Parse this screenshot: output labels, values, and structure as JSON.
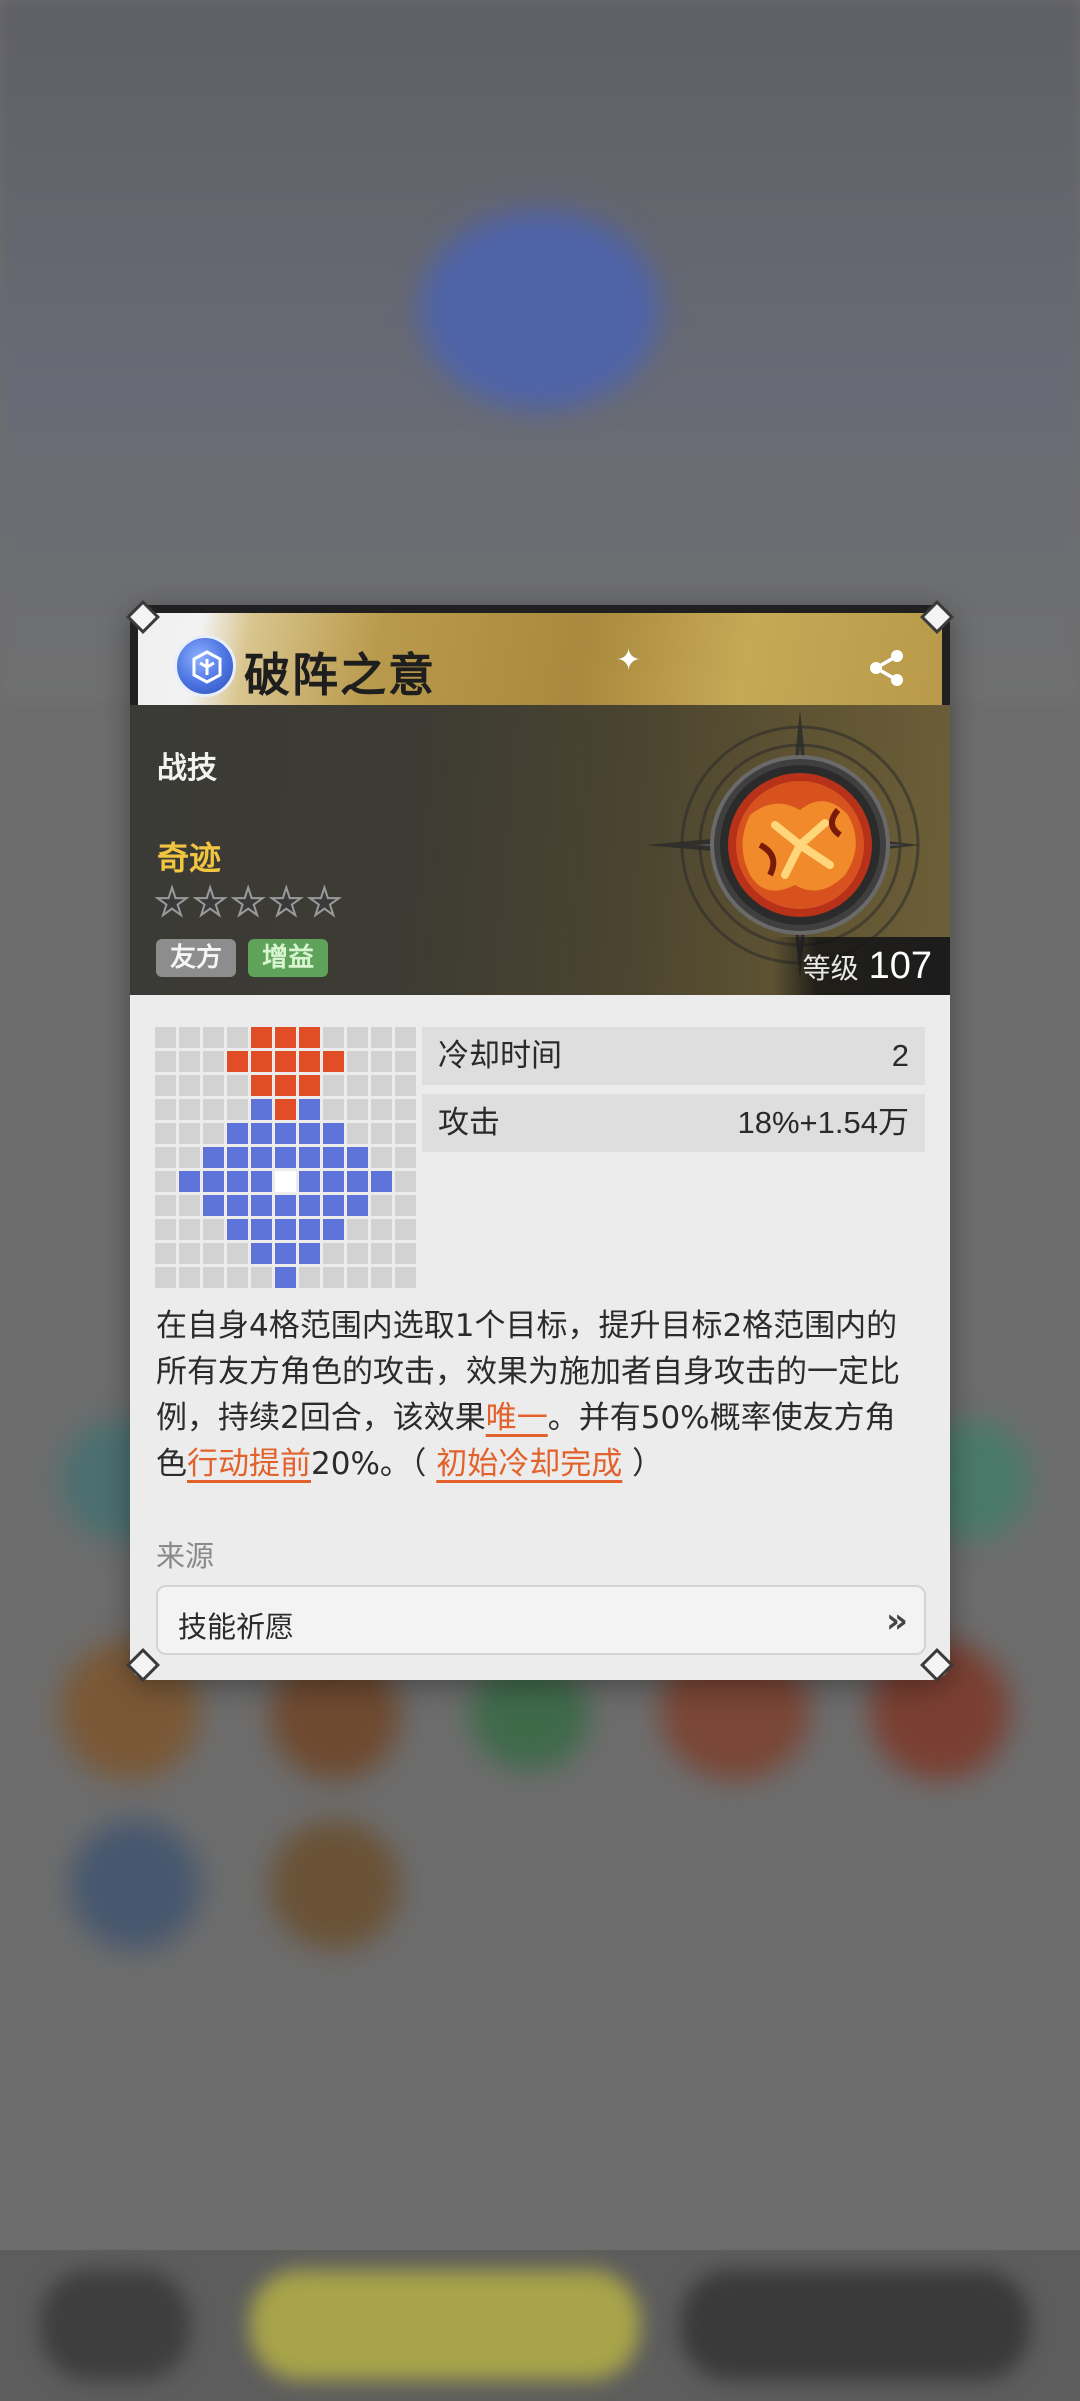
{
  "skill": {
    "name": "破阵之意",
    "type": "战技",
    "rarity": "奇迹",
    "star_count": 5,
    "stars_filled": 0,
    "tags": [
      "友方",
      "增益"
    ],
    "level_label": "等级",
    "level_value": "107"
  },
  "stats": [
    {
      "label": "冷却时间",
      "value": "2"
    },
    {
      "label": "攻击",
      "value": "18%+1.54万"
    }
  ],
  "description": {
    "part1": "在自身4格范围内选取1个目标，提升目标2格范围内的所有友方角色的攻击，效果为施加者自身攻击的一定比例，持续2回合，该效果",
    "link1": "唯一",
    "part2": "。并有50%概率使友方角色",
    "link2": "行动提前",
    "part3": "20%。（ ",
    "link3": "初始冷却完成",
    "part4": " ）"
  },
  "source": {
    "label": "来源",
    "item": "技能祈愿",
    "chevron": "»"
  },
  "icons": {
    "title_icon": "skill-class-icon",
    "share": "share-icon",
    "sparkle": "sparkle-icon"
  },
  "colors": {
    "accent_orange": "#e3622b",
    "grid_red": "#e14d25",
    "grid_blue": "#5f74d8",
    "rarity_gold": "#f2c541",
    "tag_green": "#5fa25a"
  },
  "range_grid": {
    "size": 11,
    "rows": [
      "...........",
      ".....r.....",
      "....rrr....",
      "...rrrrr...",
      "....rrr....",
      "....brb....",
      "...bbbbb...",
      "..bbbbbbb..",
      ".bbbbwbbbb.",
      "..bbbbbbb..",
      "...bbbbb...",
      "....bbb....",
      ".....b....."
    ]
  }
}
